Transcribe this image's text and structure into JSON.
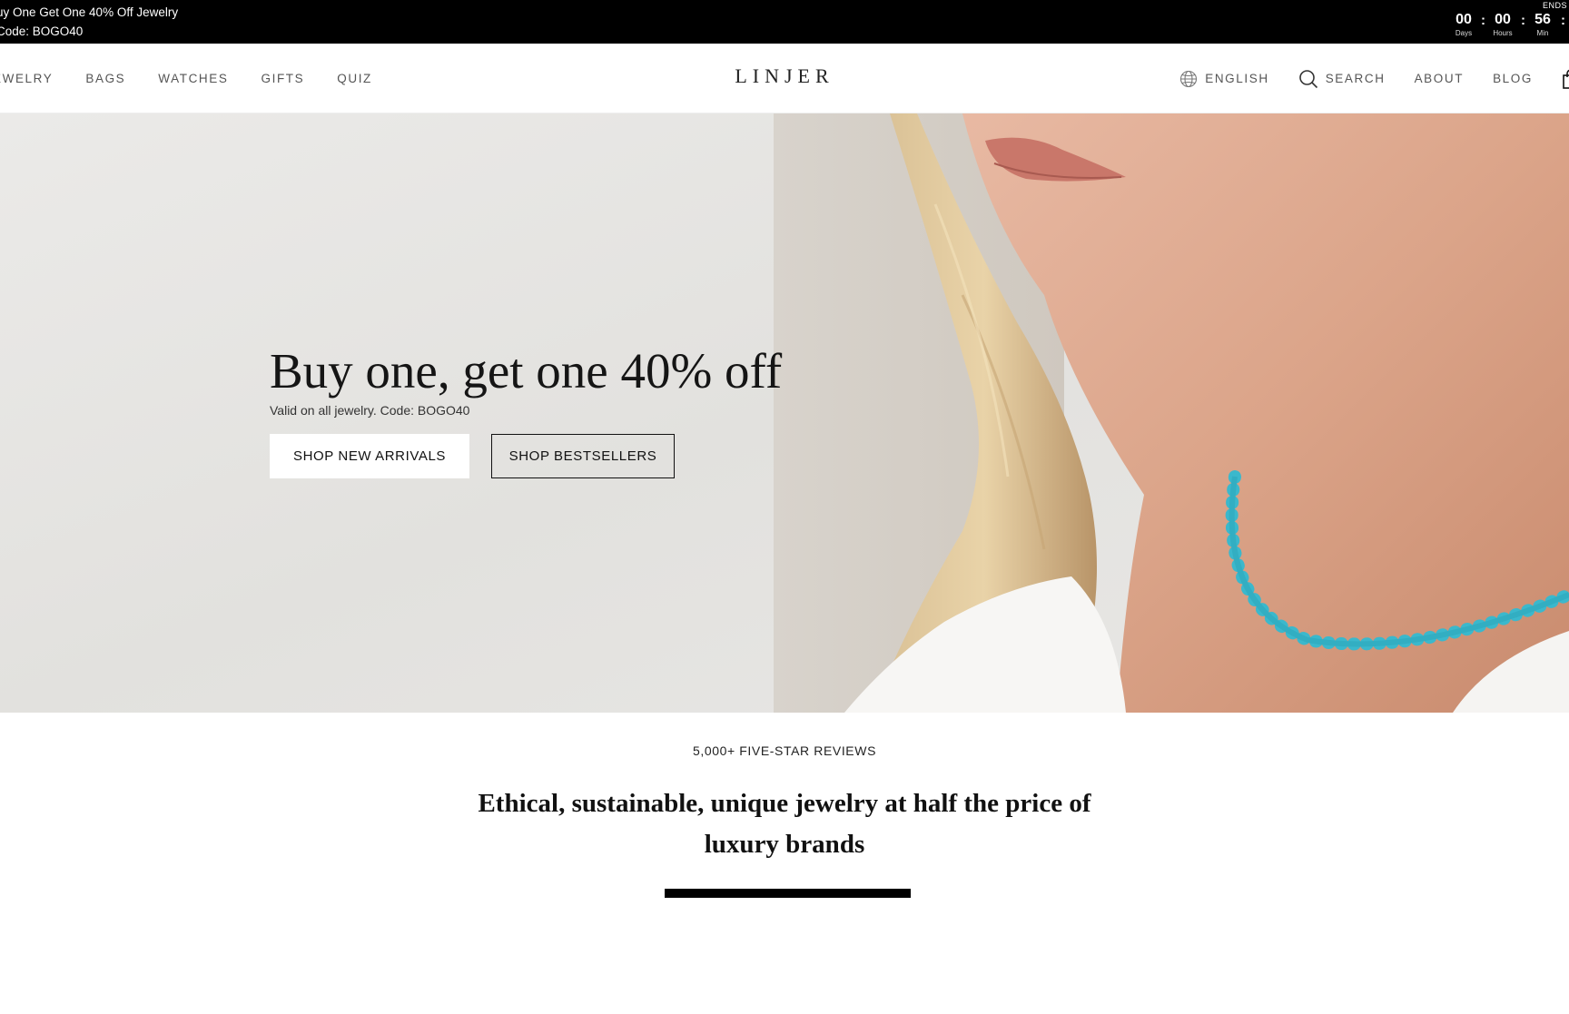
{
  "promo": {
    "line1": "uy One Get One 40% Off Jewelry",
    "line2": "Code: BOGO40"
  },
  "countdown": {
    "ends_label": "ENDS",
    "days": "00",
    "days_label": "Days",
    "hours": "00",
    "hours_label": "Hours",
    "minutes": "56",
    "minutes_label": "Min",
    "separator": ":"
  },
  "nav": {
    "left": [
      "EWELRY",
      "BAGS",
      "WATCHES",
      "GIFTS",
      "QUIZ"
    ],
    "logo": "LINJER",
    "language": "ENGLISH",
    "search": "SEARCH",
    "about": "ABOUT",
    "blog": "BLOG"
  },
  "hero": {
    "title": "Buy one, get one 40% off",
    "subtitle": "Valid on all jewelry. Code: BOGO40",
    "button_new_arrivals": "SHOP NEW ARRIVALS",
    "button_bestsellers": "SHOP BESTSELLERS"
  },
  "reviews": {
    "label": "5,000+ FIVE-STAR REVIEWS",
    "tagline": "Ethical, sustainable, unique jewelry at half the price of luxury brands"
  },
  "icons": {
    "language": "globe-icon",
    "search": "search-icon",
    "cart": "shopping-bag-icon"
  },
  "colors": {
    "announcement_bg": "#000000",
    "necklace": "#3bb8cc"
  }
}
